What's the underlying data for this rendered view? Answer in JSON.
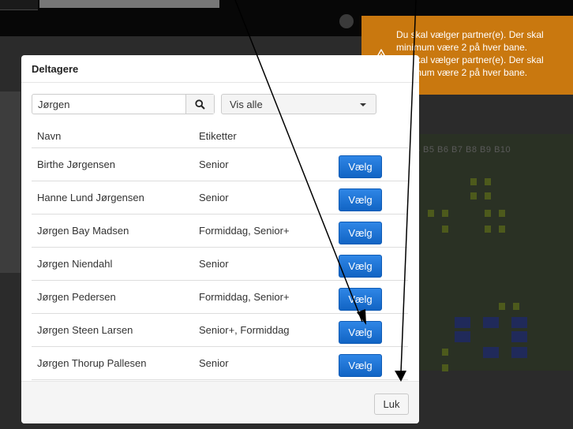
{
  "toast": {
    "icon": "warning-icon",
    "messages": [
      "Du skal vælger partner(e). Der skal minimum være 2 på hver bane.",
      "Du skal vælger partner(e). Der skal minimum være 2 på hver bane."
    ],
    "color": "#c9780f"
  },
  "background": {
    "grid_header": "B4 B5 B6 B7 B8 B9 B10"
  },
  "modal": {
    "title": "Deltagere",
    "search": {
      "value": "Jørgen",
      "icon": "search-icon"
    },
    "filter": {
      "selected": "Vis alle",
      "icon": "caret-down-icon"
    },
    "columns": {
      "name": "Navn",
      "tags": "Etiketter"
    },
    "rows": [
      {
        "name": "Birthe Jørgensen",
        "tags": "Senior",
        "action": "Vælg"
      },
      {
        "name": "Hanne Lund Jørgensen",
        "tags": "Senior",
        "action": "Vælg"
      },
      {
        "name": "Jørgen Bay Madsen",
        "tags": "Formiddag, Senior+",
        "action": "Vælg"
      },
      {
        "name": "Jørgen Niendahl",
        "tags": "Senior",
        "action": "Vælg"
      },
      {
        "name": "Jørgen Pedersen",
        "tags": "Formiddag, Senior+",
        "action": "Vælg"
      },
      {
        "name": "Jørgen Steen Larsen",
        "tags": "Senior+, Formiddag",
        "action": "Vælg"
      },
      {
        "name": "Jørgen Thorup Pallesen",
        "tags": "Senior",
        "action": "Vælg"
      }
    ],
    "close_label": "Luk",
    "accent": "#1a73d9"
  }
}
